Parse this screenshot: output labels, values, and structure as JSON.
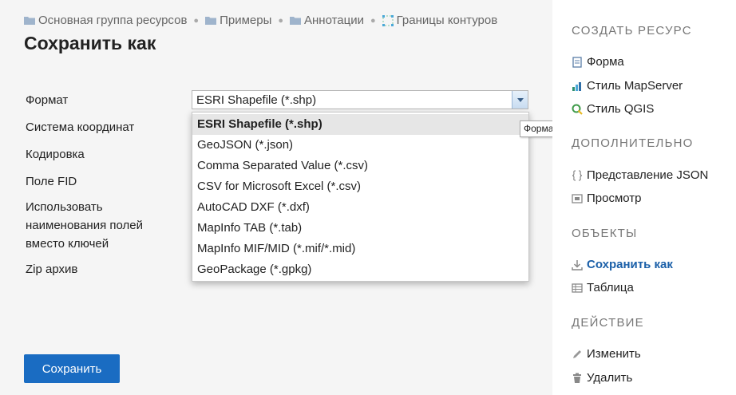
{
  "breadcrumb": [
    {
      "label": "Основная группа ресурсов",
      "icon": "folder-icon"
    },
    {
      "label": "Примеры",
      "icon": "folder-icon"
    },
    {
      "label": "Аннотации",
      "icon": "folder-icon"
    },
    {
      "label": "Границы контуров",
      "icon": "vector-layer-icon"
    }
  ],
  "page": {
    "title": "Сохранить как"
  },
  "form": {
    "labels": {
      "format": "Формат",
      "crs": "Система координат",
      "encoding": "Кодировка",
      "fid": "Поле FID",
      "use_display_name": "Использовать наименования полей вместо ключей",
      "zip": "Zip архив"
    },
    "format_select": {
      "value": "ESRI Shapefile (*.shp)",
      "options": [
        "ESRI Shapefile (*.shp)",
        "GeoJSON (*.json)",
        "Comma Separated Value (*.csv)",
        "CSV for Microsoft Excel (*.csv)",
        "AutoCAD DXF (*.dxf)",
        "MapInfo TAB (*.tab)",
        "MapInfo MIF/MID (*.mif/*.mid)",
        "GeoPackage (*.gpkg)"
      ]
    },
    "tooltip": "Формат",
    "save_label": "Сохранить"
  },
  "sidebar": {
    "sections": [
      {
        "heading": "СОЗДАТЬ РЕСУРС",
        "items": [
          {
            "label": "Форма",
            "icon": "form-icon"
          },
          {
            "label": "Стиль MapServer",
            "icon": "mapserver-style-icon"
          },
          {
            "label": "Стиль QGIS",
            "icon": "qgis-style-icon"
          }
        ]
      },
      {
        "heading": "ДОПОЛНИТЕЛЬНО",
        "items": [
          {
            "label": "Представление JSON",
            "icon": "braces-icon"
          },
          {
            "label": "Просмотр",
            "icon": "preview-icon"
          }
        ]
      },
      {
        "heading": "ОБЪЕКТЫ",
        "items": [
          {
            "label": "Сохранить как",
            "icon": "download-icon",
            "active": true
          },
          {
            "label": "Таблица",
            "icon": "table-icon"
          }
        ]
      },
      {
        "heading": "ДЕЙСТВИЕ",
        "items": [
          {
            "label": "Изменить",
            "icon": "pencil-icon"
          },
          {
            "label": "Удалить",
            "icon": "trash-icon"
          }
        ]
      }
    ]
  },
  "colors": {
    "accent": "#1a6cc2",
    "active_link": "#1a5fa8",
    "sidebar_heading": "#777777"
  }
}
